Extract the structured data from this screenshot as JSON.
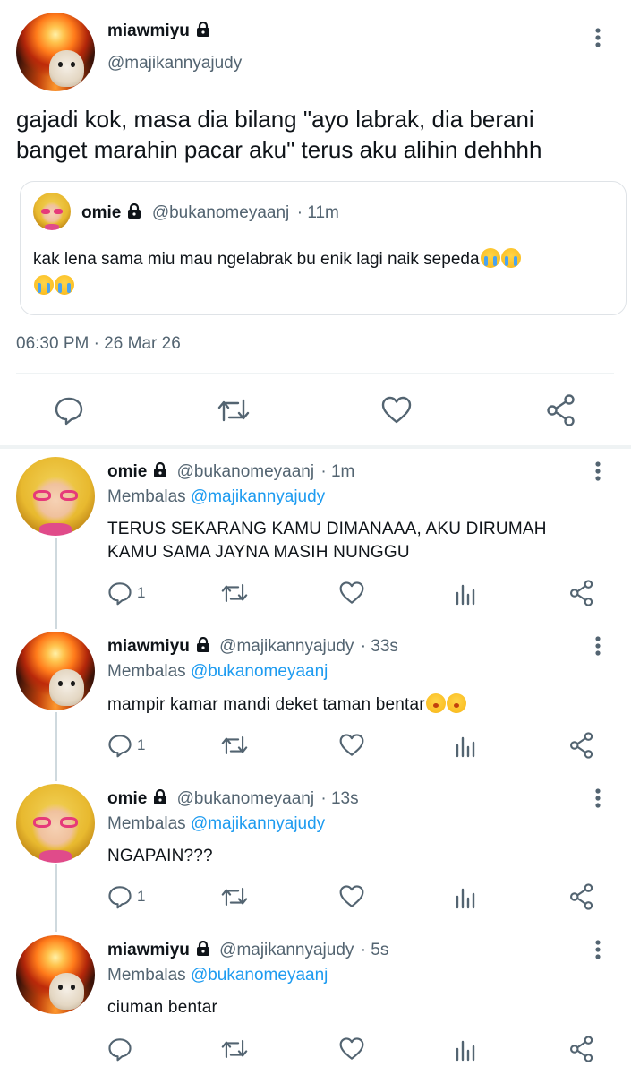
{
  "tweet": {
    "display_name": "miawmiyu",
    "handle": "@majikannyajudy",
    "text_line1": "gajadi kok, masa dia bilang \"ayo labrak, dia berani",
    "text_line2": "banget marahin pacar aku\" terus aku alihin dehhhh",
    "quote": {
      "display_name": "omie",
      "handle": "@bukanomeyaanj",
      "time": "· 11m",
      "text": "kak lena sama miu mau ngelabrak bu enik lagi naik sepeda"
    },
    "timestamp": "06:30 PM · 26 Mar 26"
  },
  "replies": [
    {
      "display_name": "omie",
      "handle": "@bukanomeyaanj",
      "time": "· 1m",
      "reply_prefix": "Membalas",
      "reply_to": "@majikannyajudy",
      "text_line1": "TERUS SEKARANG KAMU DIMANAAA, AKU DIRUMAH",
      "text_line2": "KAMU SAMA JAYNA MASIH NUNGGU",
      "reply_count": "1"
    },
    {
      "display_name": "miawmiyu",
      "handle": "@majikannyajudy",
      "time": "· 33s",
      "reply_prefix": "Membalas",
      "reply_to": "@bukanomeyaanj",
      "text_line1": "mampir kamar mandi deket taman bentar",
      "reply_count": "1"
    },
    {
      "display_name": "omie",
      "handle": "@bukanomeyaanj",
      "time": "· 13s",
      "reply_prefix": "Membalas",
      "reply_to": "@majikannyajudy",
      "text_line1": "NGAPAIN???",
      "reply_count": "1"
    },
    {
      "display_name": "miawmiyu",
      "handle": "@majikannyajudy",
      "time": "· 5s",
      "reply_prefix": "Membalas",
      "reply_to": "@bukanomeyaanj",
      "text_line1": "ciuman bentar",
      "reply_count": ""
    }
  ],
  "icons": {
    "reply": "comment-icon",
    "retweet": "retweet-icon",
    "like": "heart-icon",
    "stats": "analytics-icon",
    "share": "share-icon",
    "more": "more-vertical-icon",
    "protected": "lock-icon"
  },
  "colors": {
    "text": "#0f1419",
    "secondary": "#536471",
    "link": "#1d9bf0",
    "divider": "#eff3f4"
  }
}
